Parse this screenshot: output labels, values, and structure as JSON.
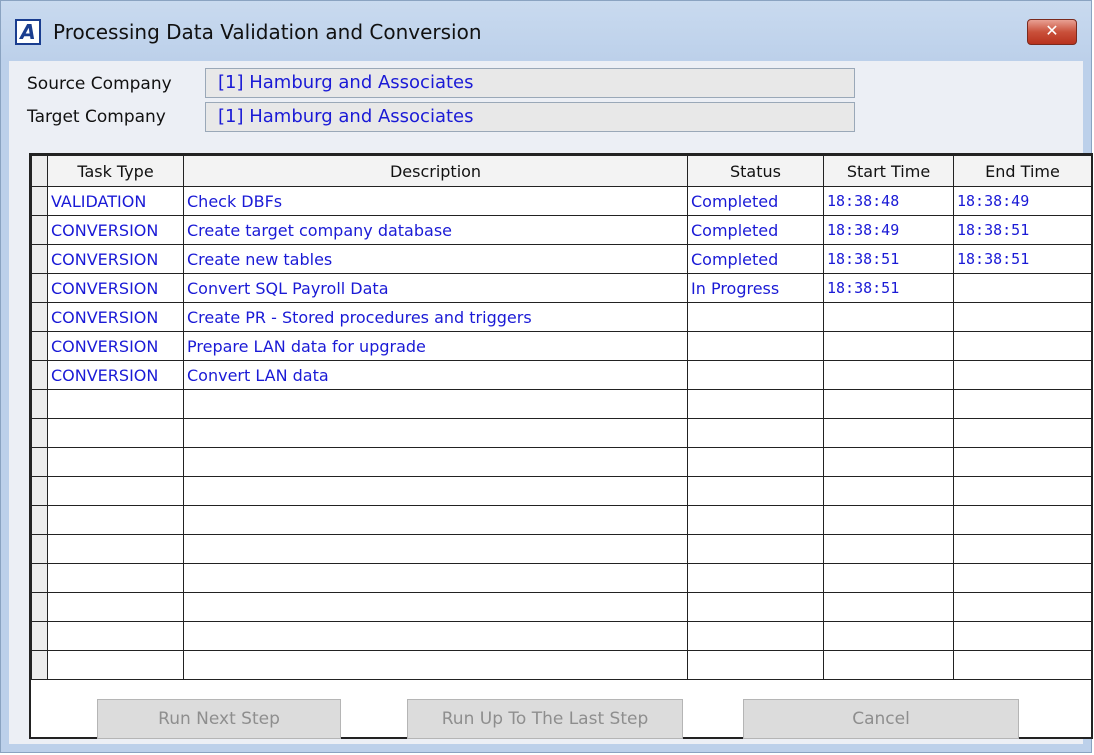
{
  "window": {
    "title": "Processing Data Validation and Conversion",
    "icon_letter": "A",
    "close_glyph": "✕"
  },
  "fields": {
    "source_label": "Source Company",
    "source_value": "[1] Hamburg and Associates",
    "target_label": "Target Company",
    "target_value": "[1] Hamburg and Associates"
  },
  "grid": {
    "columns": [
      "Task Type",
      "Description",
      "Status",
      "Start Time",
      "End Time"
    ],
    "rows": [
      [
        "VALIDATION",
        "Check DBFs",
        "Completed",
        "18:38:48",
        "18:38:49"
      ],
      [
        "CONVERSION",
        "Create target company database",
        "Completed",
        "18:38:49",
        "18:38:51"
      ],
      [
        "CONVERSION",
        "Create new tables",
        "Completed",
        "18:38:51",
        "18:38:51"
      ],
      [
        "CONVERSION",
        "Convert SQL Payroll Data",
        "In Progress",
        "18:38:51",
        ""
      ],
      [
        "CONVERSION",
        "Create PR - Stored procedures and triggers",
        "",
        "",
        ""
      ],
      [
        "CONVERSION",
        "Prepare LAN data for upgrade",
        "",
        "",
        ""
      ],
      [
        "CONVERSION",
        "Convert LAN data",
        "",
        "",
        ""
      ],
      [
        "",
        "",
        "",
        "",
        ""
      ],
      [
        "",
        "",
        "",
        "",
        ""
      ],
      [
        "",
        "",
        "",
        "",
        ""
      ],
      [
        "",
        "",
        "",
        "",
        ""
      ],
      [
        "",
        "",
        "",
        "",
        ""
      ],
      [
        "",
        "",
        "",
        "",
        ""
      ],
      [
        "",
        "",
        "",
        "",
        ""
      ],
      [
        "",
        "",
        "",
        "",
        ""
      ],
      [
        "",
        "",
        "",
        "",
        ""
      ],
      [
        "",
        "",
        "",
        "",
        ""
      ]
    ]
  },
  "buttons": {
    "run_next": "Run Next Step",
    "run_all": "Run Up To The Last Step",
    "cancel": "Cancel"
  },
  "colors": {
    "value_text": "#1a1ad6",
    "disabled_text": "#8e8e8e"
  }
}
